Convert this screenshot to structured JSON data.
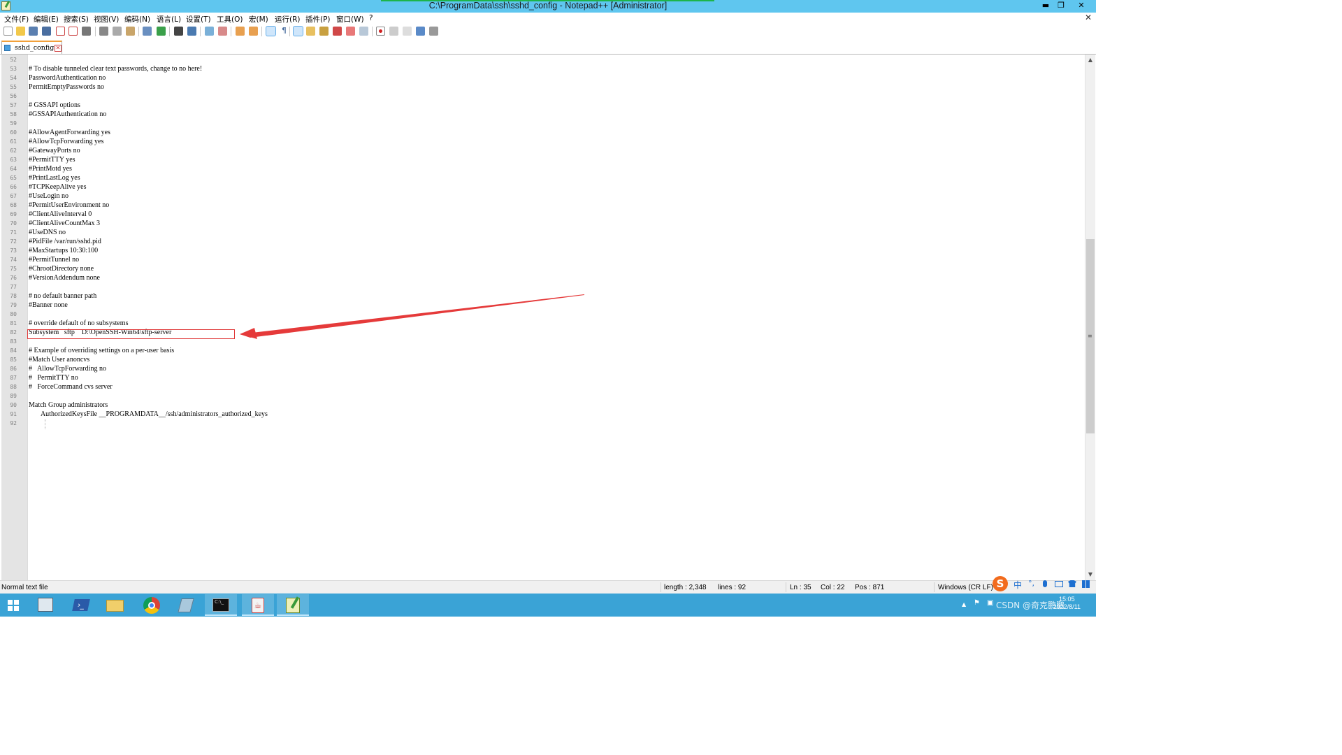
{
  "window": {
    "title": "C:\\ProgramData\\ssh\\sshd_config - Notepad++ [Administrator]",
    "minimize": "▬",
    "restore": "❐",
    "close": "✕"
  },
  "menu": [
    "文件(F)",
    "编辑(E)",
    "搜索(S)",
    "视图(V)",
    "编码(N)",
    "语言(L)",
    "设置(T)",
    "工具(O)",
    "宏(M)",
    "运行(R)",
    "插件(P)",
    "窗口(W)",
    "?"
  ],
  "menu_close": "✕",
  "tab": {
    "label": "sshd_config",
    "close": "✕"
  },
  "editor": {
    "lines": [
      {
        "n": "52",
        "t": ""
      },
      {
        "n": "53",
        "t": "# To disable tunneled clear text passwords, change to no here!"
      },
      {
        "n": "54",
        "t": "PasswordAuthentication no"
      },
      {
        "n": "55",
        "t": "PermitEmptyPasswords no"
      },
      {
        "n": "56",
        "t": ""
      },
      {
        "n": "57",
        "t": "# GSSAPI options"
      },
      {
        "n": "58",
        "t": "#GSSAPIAuthentication no"
      },
      {
        "n": "59",
        "t": ""
      },
      {
        "n": "60",
        "t": "#AllowAgentForwarding yes"
      },
      {
        "n": "61",
        "t": "#AllowTcpForwarding yes"
      },
      {
        "n": "62",
        "t": "#GatewayPorts no"
      },
      {
        "n": "63",
        "t": "#PermitTTY yes"
      },
      {
        "n": "64",
        "t": "#PrintMotd yes"
      },
      {
        "n": "65",
        "t": "#PrintLastLog yes"
      },
      {
        "n": "66",
        "t": "#TCPKeepAlive yes"
      },
      {
        "n": "67",
        "t": "#UseLogin no"
      },
      {
        "n": "68",
        "t": "#PermitUserEnvironment no"
      },
      {
        "n": "69",
        "t": "#ClientAliveInterval 0"
      },
      {
        "n": "70",
        "t": "#ClientAliveCountMax 3"
      },
      {
        "n": "71",
        "t": "#UseDNS no"
      },
      {
        "n": "72",
        "t": "#PidFile /var/run/sshd.pid"
      },
      {
        "n": "73",
        "t": "#MaxStartups 10:30:100"
      },
      {
        "n": "74",
        "t": "#PermitTunnel no"
      },
      {
        "n": "75",
        "t": "#ChrootDirectory none"
      },
      {
        "n": "76",
        "t": "#VersionAddendum none"
      },
      {
        "n": "77",
        "t": ""
      },
      {
        "n": "78",
        "t": "# no default banner path"
      },
      {
        "n": "79",
        "t": "#Banner none"
      },
      {
        "n": "80",
        "t": ""
      },
      {
        "n": "81",
        "t": "# override default of no subsystems"
      },
      {
        "n": "82",
        "t": "Subsystem   sftp    D:\\OpenSSH-Win64\\sftp-server"
      },
      {
        "n": "83",
        "t": ""
      },
      {
        "n": "84",
        "t": "# Example of overriding settings on a per-user basis"
      },
      {
        "n": "85",
        "t": "#Match User anoncvs"
      },
      {
        "n": "86",
        "t": "#   AllowTcpForwarding no"
      },
      {
        "n": "87",
        "t": "#   PermitTTY no"
      },
      {
        "n": "88",
        "t": "#   ForceCommand cvs server"
      },
      {
        "n": "89",
        "t": ""
      },
      {
        "n": "90",
        "t": "Match Group administrators"
      },
      {
        "n": "91",
        "t": "       AuthorizedKeysFile __PROGRAMDATA__/ssh/administrators_authorized_keys"
      },
      {
        "n": "92",
        "t": ""
      }
    ]
  },
  "statusbar": {
    "file_type": "Normal text file",
    "length": "length : 2,348",
    "lines": "lines : 92",
    "ln": "Ln : 35",
    "col": "Col : 22",
    "pos": "Pos : 871",
    "eol": "Windows (CR LF)"
  },
  "ime": {
    "logo": "S",
    "mode": "中",
    "punct": "°,"
  },
  "taskbar": {
    "apps": [
      "windows-start",
      "server-manager",
      "powershell",
      "file-explorer",
      "chrome",
      "notepad",
      "cmd",
      "java",
      "notepad-plus-plus"
    ],
    "tray_text": "CSDN @奇克鹏鹏",
    "time": "15:05",
    "date": "2022/8/11"
  },
  "colors": {
    "titlebar": "#5fc6ef",
    "taskbar": "#3aa3d6",
    "highlight": "#e03a3a",
    "tab_accent": "#f2a03a"
  }
}
